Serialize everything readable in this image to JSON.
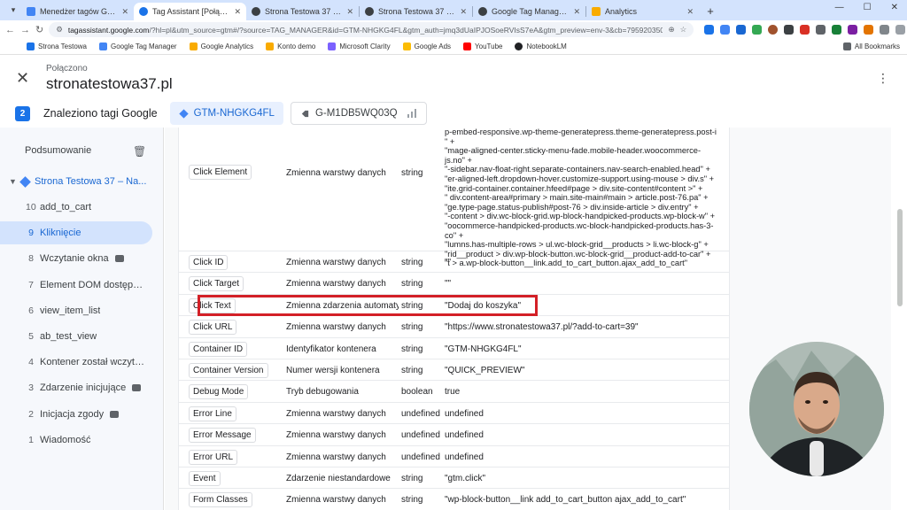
{
  "browser": {
    "tabs": [
      {
        "title": "Menedżer tagów Google",
        "active": false,
        "color": "#4285f4"
      },
      {
        "title": "Tag Assistant [Połączono]",
        "active": true,
        "color": "#1a73e8"
      },
      {
        "title": "Strona Testowa 37 – Na tej stro",
        "active": false,
        "color": "#3c4043"
      },
      {
        "title": "Strona Testowa 37 – Na tej stro",
        "active": false,
        "color": "#3c4043"
      },
      {
        "title": "Google Tag Manager for Wordp",
        "active": false,
        "color": "#3c4043"
      },
      {
        "title": "Analytics",
        "active": false,
        "color": "#f9ab00"
      }
    ],
    "url_host": "tagassistant.google.com",
    "url_rest": "/?hl=pl&utm_source=gtm#/?source=TAG_MANAGER&id=GTM-NHGKG4FL&gtm_auth=jmq3dUaIPJOSoeRVIsS7eA&gtm_preview=env-3&cb=7959203502453332",
    "bookmarks": [
      {
        "label": "Strona Testowa",
        "color": "#1a73e8"
      },
      {
        "label": "Google Tag Manager",
        "color": "#4285f4"
      },
      {
        "label": "Google Analytics",
        "color": "#f9ab00"
      },
      {
        "label": "Konto demo",
        "color": "#f9ab00"
      },
      {
        "label": "Microsoft Clarity",
        "color": "#7b61ff"
      },
      {
        "label": "Google Ads",
        "color": "#fbbc04"
      },
      {
        "label": "YouTube",
        "color": "#ff0000"
      },
      {
        "label": "NotebookLM",
        "color": "#202124"
      }
    ],
    "all_bookmarks": "All Bookmarks"
  },
  "header": {
    "status": "Połączono",
    "domain": "stronatestowa37.pl"
  },
  "tagbar": {
    "count": "2",
    "found_label": "Znaleziono tagi Google",
    "container_selected": "GTM-NHGKG4FL",
    "container_other": "G-M1DB5WQ03Q"
  },
  "sidebar": {
    "summary": "Podsumowanie",
    "page": "Strona Testowa 37 – Na...",
    "items": [
      {
        "num": "10",
        "label": "add_to_cart",
        "badge": false
      },
      {
        "num": "9",
        "label": "Kliknięcie",
        "badge": false,
        "active": true
      },
      {
        "num": "8",
        "label": "Wczytanie okna",
        "badge": true
      },
      {
        "num": "7",
        "label": "Element DOM dostępny ...",
        "badge": false
      },
      {
        "num": "6",
        "label": "view_item_list",
        "badge": false
      },
      {
        "num": "5",
        "label": "ab_test_view",
        "badge": false
      },
      {
        "num": "4",
        "label": "Kontener został wczyta...",
        "badge": false
      },
      {
        "num": "3",
        "label": "Zdarzenie inicjujące",
        "badge": true
      },
      {
        "num": "2",
        "label": "Inicjacja zgody",
        "badge": true
      },
      {
        "num": "1",
        "label": "Wiadomość",
        "badge": false
      }
    ]
  },
  "variables": {
    "click_element": {
      "name": "Click Element",
      "type": "Zmienna warstwy danych",
      "kind": "string",
      "value_lines": [
        "p-embed-responsive.wp-theme-generatepress.theme-generatepress.post-i",
        "\" +",
        "\"mage-aligned-center.sticky-menu-fade.mobile-header.woocommerce-",
        "js.no\" +",
        "\"-sidebar.nav-float-right.separate-containers.nav-search-enabled.head\" +",
        "\"er-aligned-left.dropdown-hover.customize-support.using-mouse > div.s\" +",
        "\"ite.grid-container.container.hfeed#page > div.site-content#content >\" +",
        "\" div.content-area#primary > main.site-main#main > article.post-76.pa\" +",
        "\"ge.type-page.status-publish#post-76 > div.inside-article > div.entry\" +",
        "\"-content > div.wc-block-grid.wp-block-handpicked-products.wp-block-w\" +",
        "\"oocommerce-handpicked-products.wc-block-handpicked-products.has-3-",
        "co\" +",
        "\"lumns.has-multiple-rows > ul.wc-block-grid__products > li.wc-block-g\" +",
        "\"rid__product > div.wp-block-button.wc-block-grid__product-add-to-car\" +",
        "\"t > a.wp-block-button__link.add_to_cart_button.ajax_add_to_cart\""
      ]
    },
    "rows": [
      {
        "name": "Click ID",
        "type": "Zmienna warstwy danych",
        "kind": "string",
        "value": "\"\""
      },
      {
        "name": "Click Target",
        "type": "Zmienna warstwy danych",
        "kind": "string",
        "value": "\"\""
      },
      {
        "name": "Click Text",
        "type": "Zmienna zdarzenia automatycznego",
        "kind": "string",
        "value": "\"Dodaj do koszyka\""
      },
      {
        "name": "Click URL",
        "type": "Zmienna warstwy danych",
        "kind": "string",
        "value": "\"https://www.stronatestowa37.pl/?add-to-cart=39\""
      },
      {
        "name": "Container ID",
        "type": "Identyfikator kontenera",
        "kind": "string",
        "value": "\"GTM-NHGKG4FL\""
      },
      {
        "name": "Container Version",
        "type": "Numer wersji kontenera",
        "kind": "string",
        "value": "\"QUICK_PREVIEW\""
      },
      {
        "name": "Debug Mode",
        "type": "Tryb debugowania",
        "kind": "boolean",
        "value": "true"
      },
      {
        "name": "Error Line",
        "type": "Zmienna warstwy danych",
        "kind": "undefined",
        "value": "undefined"
      },
      {
        "name": "Error Message",
        "type": "Zmienna warstwy danych",
        "kind": "undefined",
        "value": "undefined"
      },
      {
        "name": "Error URL",
        "type": "Zmienna warstwy danych",
        "kind": "undefined",
        "value": "undefined"
      },
      {
        "name": "Event",
        "type": "Zdarzenie niestandardowe",
        "kind": "string",
        "value": "\"gtm.click\""
      },
      {
        "name": "Form Classes",
        "type": "Zmienna warstwy danych",
        "kind": "string",
        "value": "\"wp-block-button__link  add_to_cart_button ajax_add_to_cart\""
      }
    ]
  },
  "colors": {
    "accent": "#1a73e8",
    "highlight": "#d32027"
  }
}
